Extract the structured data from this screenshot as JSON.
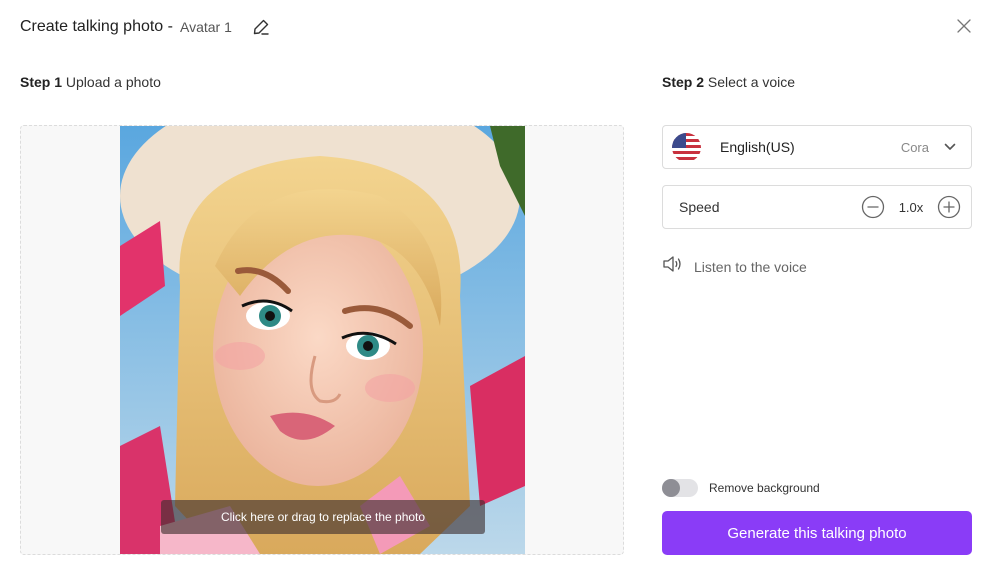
{
  "header": {
    "title": "Create talking photo -",
    "avatar_name": "Avatar 1",
    "edit_icon": "pencil-icon",
    "close_icon": "close-icon"
  },
  "step1": {
    "step": "Step 1",
    "label": "Upload a photo",
    "photo_alt": "Cartoon avatar of a blonde woman with teal eyes",
    "replace_hint": "Click here or drag to replace the photo"
  },
  "step2": {
    "step": "Step 2",
    "label": "Select a voice",
    "voice": {
      "flag_icon": "us-flag-icon",
      "language": "English(US)",
      "name": "Cora",
      "dropdown_icon": "chevron-down-icon"
    },
    "speed": {
      "label": "Speed",
      "value": "1.0x",
      "decrease_icon": "minus-circle-icon",
      "increase_icon": "plus-circle-icon"
    },
    "listen": {
      "icon": "speaker-icon",
      "label": "Listen to the voice"
    }
  },
  "options": {
    "remove_background": {
      "label": "Remove background",
      "enabled": false
    }
  },
  "actions": {
    "generate_label": "Generate this talking photo"
  },
  "colors": {
    "primary": "#8a3cf7",
    "toggle_off_knob": "#8e8e95",
    "border": "#dcdcdc"
  }
}
